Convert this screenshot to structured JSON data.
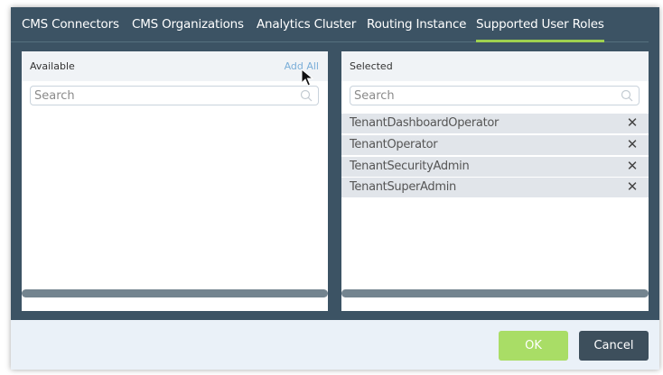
{
  "tabs": [
    {
      "label": "CMS Connectors"
    },
    {
      "label": "CMS Organizations"
    },
    {
      "label": "Analytics Cluster"
    },
    {
      "label": "Routing Instance"
    },
    {
      "label": "Supported User Roles"
    }
  ],
  "active_tab": "Supported User Roles",
  "available": {
    "title": "Available",
    "add_all_label": "Add All",
    "search_placeholder": "Search",
    "items": []
  },
  "selected": {
    "title": "Selected",
    "search_placeholder": "Search",
    "items": [
      {
        "label": "TenantDashboardOperator"
      },
      {
        "label": "TenantOperator"
      },
      {
        "label": "TenantSecurityAdmin"
      },
      {
        "label": "TenantSuperAdmin"
      }
    ]
  },
  "footer": {
    "ok_label": "OK",
    "cancel_label": "Cancel"
  },
  "colors": {
    "dialog_background": "#3c5364",
    "active_tab_underline": "#9ed14f",
    "ok_button": "#a9dd66",
    "cancel_button": "#3d4f5c",
    "add_all_link": "#7aaed8"
  },
  "icons": {
    "search": "search-icon",
    "remove": "close-icon",
    "cursor": "mouse-pointer-icon"
  }
}
